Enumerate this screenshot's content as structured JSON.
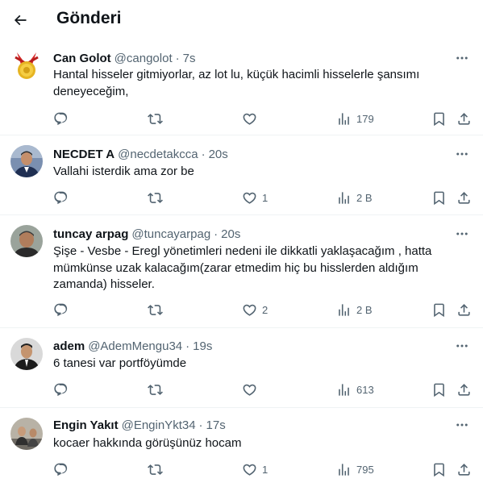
{
  "header": {
    "title": "Gönderi"
  },
  "tweets": [
    {
      "name": "Can Golot",
      "handle": "@cangolot",
      "time": "7s",
      "lines": [
        "Hantal hisseler gitmiyorlar, az lot lu, küçük hacimli hisselerle şansımı",
        "deneyeceğim,"
      ],
      "replies": "",
      "retweets": "",
      "likes": "",
      "views": "179"
    },
    {
      "name": "NECDET A",
      "handle": "@necdetakcca",
      "time": "20s",
      "lines": [
        "Vallahi isterdik ama zor be"
      ],
      "replies": "",
      "retweets": "",
      "likes": "1",
      "views": "2 B"
    },
    {
      "name": "tuncay arpag",
      "handle": "@tuncayarpag",
      "time": "20s",
      "lines": [
        "Şişe - Vesbe - Eregl yönetimleri nedeni ile dikkatli yaklaşacağım , hatta",
        "mümkünse uzak kalacağım(zarar etmedim hiç bu hisslerden aldığım",
        "zamanda) hisseler."
      ],
      "replies": "",
      "retweets": "",
      "likes": "2",
      "views": "2 B"
    },
    {
      "name": "adem",
      "handle": "@AdemMengu34",
      "time": "19s",
      "lines": [
        "6 tanesi var portföyümde"
      ],
      "replies": "",
      "retweets": "",
      "likes": "",
      "views": "613"
    },
    {
      "name": "Engin Yakıt",
      "handle": "@EnginYkt34",
      "time": "17s",
      "lines": [
        "kocaer hakkında görüşünüz hocam"
      ],
      "replies": "",
      "retweets": "",
      "likes": "1",
      "views": "795"
    }
  ]
}
